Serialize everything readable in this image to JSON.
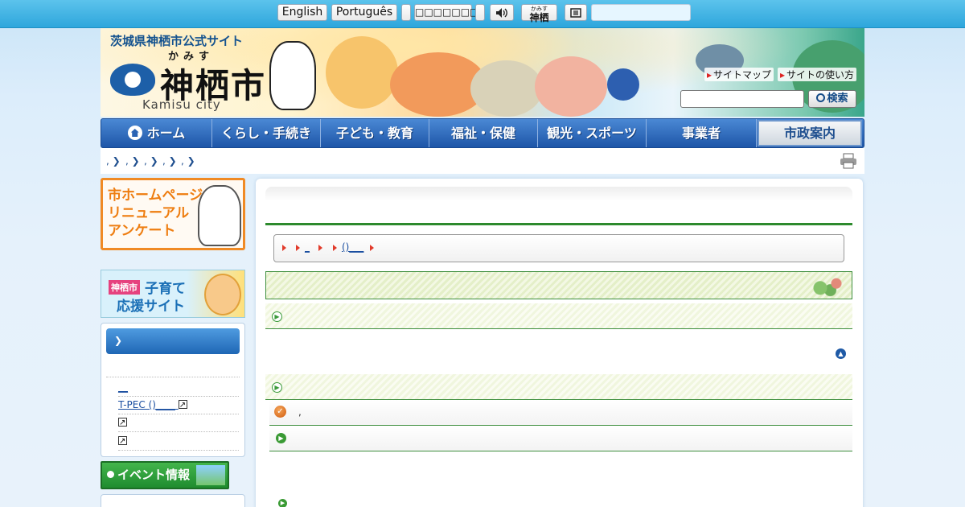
{
  "topbar": {
    "lang_english": "English",
    "lang_portuguese": "Português",
    "lang_blank1": "",
    "lang_other": "□□□□□□□",
    "lang_blank2": "",
    "voice_icon": "speaker-icon",
    "kana_ruby": "かみす",
    "kana_label": "神栖",
    "reader_icon": "document-icon",
    "search_value": ""
  },
  "header": {
    "subtitle": "茨城県神栖市公式サイト",
    "kana": "かみす",
    "city_name": "神栖市",
    "city_en": "Kamisu city",
    "sitemap_link": "サイトマップ",
    "howto_link": "サイトの使い方",
    "search_placeholder": "",
    "search_button": "検索"
  },
  "nav": {
    "items": [
      {
        "label": "ホーム"
      },
      {
        "label": "くらし・手続き"
      },
      {
        "label": "子ども・教育"
      },
      {
        "label": "福祉・保健"
      },
      {
        "label": "観光・スポーツ"
      },
      {
        "label": "事業者"
      },
      {
        "label": "市政案内"
      }
    ]
  },
  "breadcrumb_top": {
    "items": [
      ",",
      ",",
      ",",
      ",",
      ","
    ]
  },
  "sidebar": {
    "survey_banner_l1": "市ホームページ",
    "survey_banner_l2": "リニューアル",
    "survey_banner_l3": "アンケート",
    "kids_tag": "神栖市",
    "kids_l1": "子育て",
    "kids_l2": "応援サイト",
    "box_head": "",
    "links": [
      {
        "label": "__"
      },
      {
        "label": "T-PEC ()____"
      },
      {
        "label": ""
      },
      {
        "label": ""
      }
    ],
    "event_banner": "イベント情報"
  },
  "main": {
    "page_title": "",
    "breadcrumb": [
      "",
      "",
      "_",
      "",
      "()___",
      ""
    ],
    "h2": "",
    "section1": "",
    "section2": "",
    "notice_text": ",",
    "link_row": ""
  },
  "colors": {
    "topbar": "#2ea6dc",
    "nav": "#1e56a8",
    "accent_green": "#2d8a2d",
    "survey_orange": "#f08a24"
  }
}
